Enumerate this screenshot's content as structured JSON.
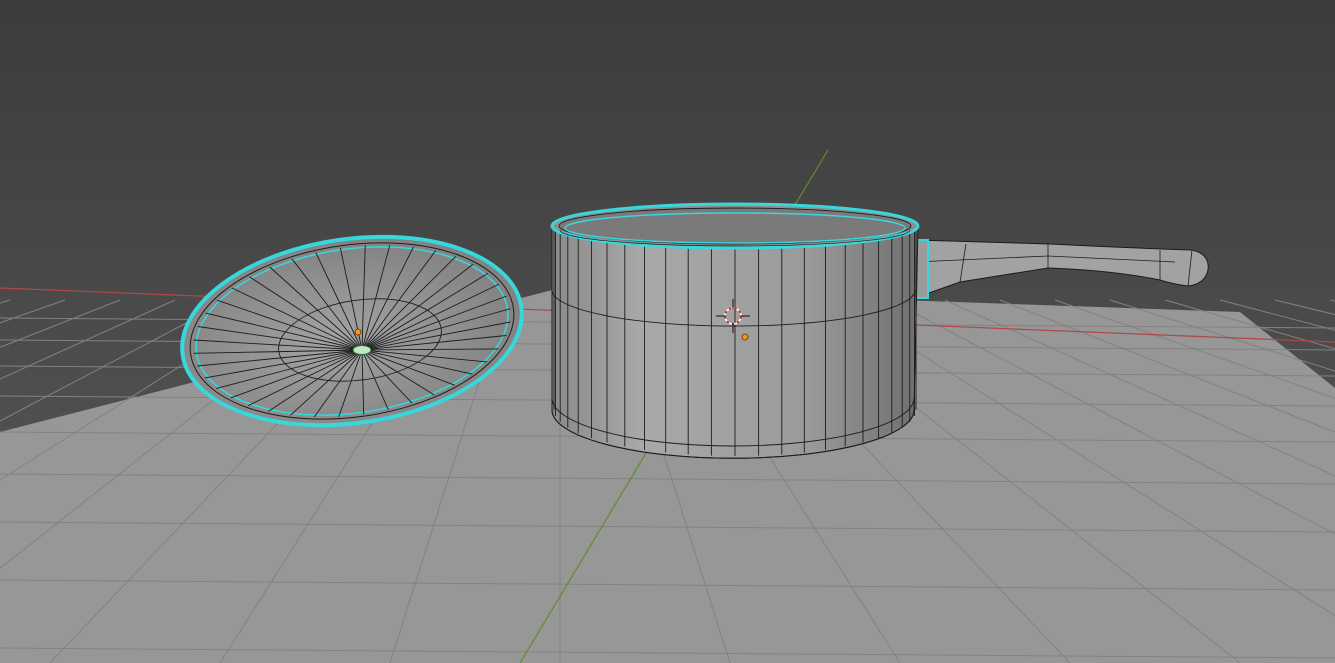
{
  "app": {
    "name": "3D viewport"
  },
  "viewport": {
    "mode": "edit",
    "view": "perspective",
    "colors": {
      "background_top": "#3c3c3c",
      "background_bottom": "#5a5a5a",
      "floor": "#979797",
      "grid_line": "#7f7f7f",
      "x_axis": "#b04848",
      "y_axis": "#5c8f2a",
      "mesh_fill": "#9a9a9a",
      "wire": "#1c1c1c",
      "selection": "#37d7dc",
      "origin": "#f39a1c",
      "cursor_red": "#d12626"
    }
  },
  "scene": {
    "objects": [
      {
        "name": "pot",
        "selected": true
      },
      {
        "name": "lid",
        "selected": true
      }
    ],
    "icons": [
      "3d-cursor-icon",
      "origin-point-icon"
    ]
  }
}
